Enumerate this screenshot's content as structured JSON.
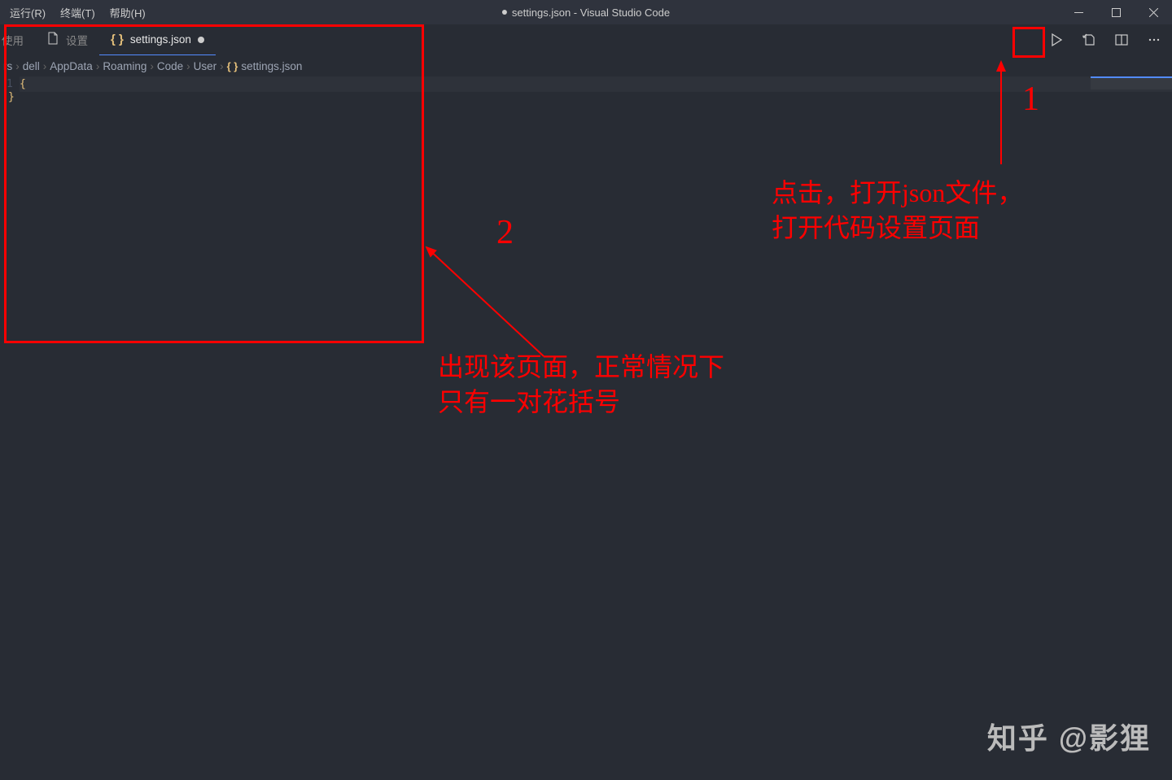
{
  "menu": {
    "run": "运行(R)",
    "terminal": "终端(T)",
    "help": "帮助(H)"
  },
  "window_title": "settings.json - Visual Studio Code",
  "tabs": {
    "partial": "使用",
    "settings_label": "设置",
    "file_label": "settings.json"
  },
  "breadcrumb": {
    "items": [
      "rs",
      "dell",
      "AppData",
      "Roaming",
      "Code",
      "User"
    ],
    "file": "settings.json"
  },
  "editor": {
    "line_number": "1",
    "content_open": "{",
    "content_close": "}"
  },
  "annotations": {
    "num1": "1",
    "num2": "2",
    "text1_line1": "点击，打开json文件，",
    "text1_line2": "打开代码设置页面",
    "text2_line1": "出现该页面，正常情况下",
    "text2_line2": "只有一对花括号"
  },
  "watermark": {
    "brand": "知乎",
    "author": "@影狸"
  }
}
